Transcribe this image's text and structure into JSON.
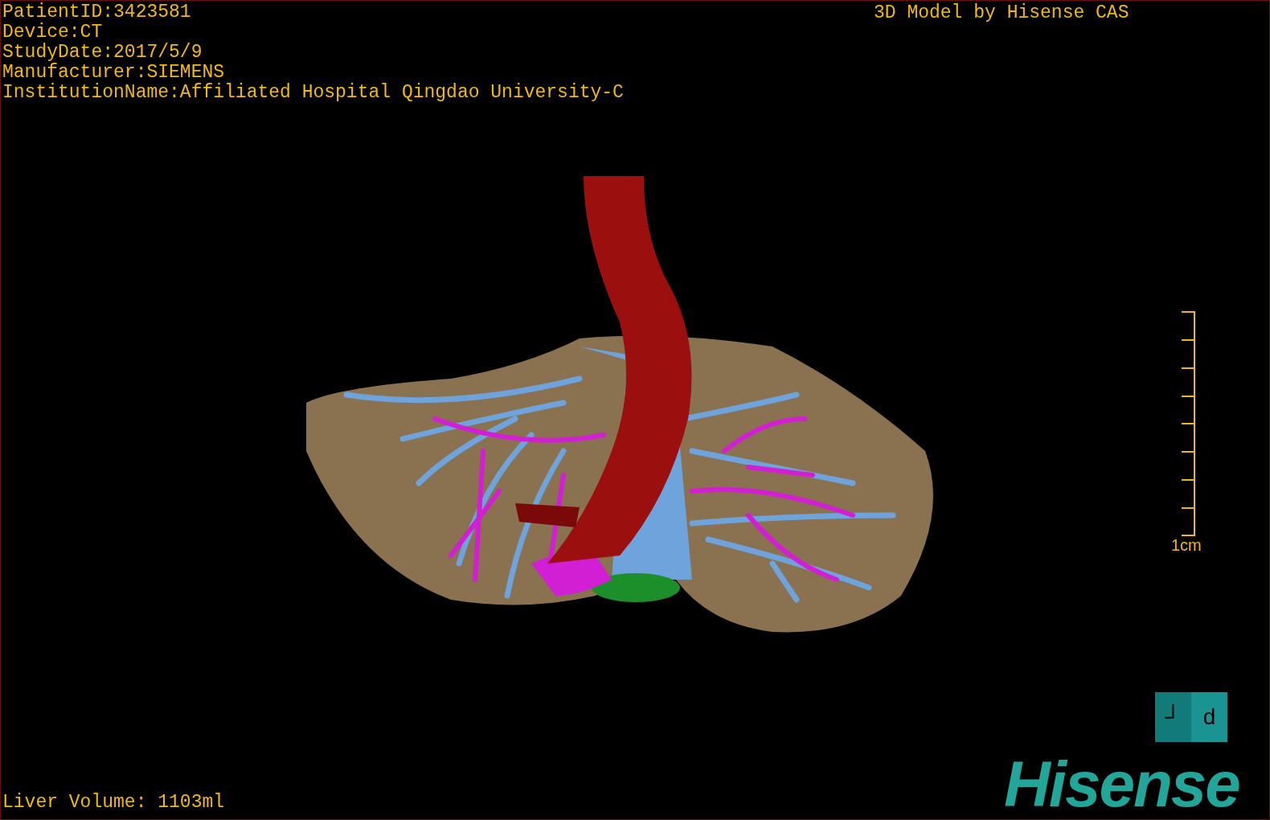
{
  "patient_info": [
    "PatientID:3423581",
    "Device:CT",
    "StudyDate:2017/5/9",
    "Manufacturer:SIEMENS",
    "InstitutionName:Affiliated Hospital Qingdao University-C"
  ],
  "credit": "3D Model by Hisense CAS",
  "scale_bar": {
    "label": "1cm"
  },
  "orientation_cube": {
    "faces": [
      "┘",
      "d"
    ]
  },
  "liver_volume": "Liver Volume: 1103ml",
  "logo": "Hisense"
}
